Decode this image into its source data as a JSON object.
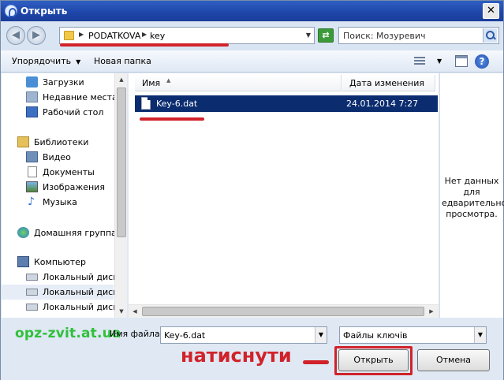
{
  "window": {
    "title": "Открыть",
    "close_glyph": "✕"
  },
  "address": {
    "segments": [
      "PODATKOVA",
      "key"
    ],
    "search_placeholder": "Поиск: Мозуревич"
  },
  "toolbar": {
    "organize_label": "Упорядочить",
    "new_folder_label": "Новая папка",
    "help_label": "?"
  },
  "nav": {
    "items": [
      {
        "label": "Загрузки",
        "icon": "downloads-icon"
      },
      {
        "label": "Недавние места",
        "icon": "recent-places-icon"
      },
      {
        "label": "Рабочий стол",
        "icon": "desktop-icon"
      },
      {
        "label": "Библиотеки",
        "icon": "libraries-icon"
      },
      {
        "label": "Видео",
        "icon": "video-icon"
      },
      {
        "label": "Документы",
        "icon": "documents-icon"
      },
      {
        "label": "Изображения",
        "icon": "pictures-icon"
      },
      {
        "label": "Музыка",
        "icon": "music-icon"
      },
      {
        "label": "Домашняя группа",
        "icon": "homegroup-icon"
      },
      {
        "label": "Компьютер",
        "icon": "computer-icon"
      },
      {
        "label": "Локальный диск (",
        "icon": "disk-icon"
      },
      {
        "label": "Локальный диск (",
        "icon": "disk-icon"
      },
      {
        "label": "Локальный диск (",
        "icon": "disk-icon"
      }
    ]
  },
  "file_list": {
    "columns": [
      "Имя",
      "Дата изменения"
    ],
    "rows": [
      {
        "name": "Key-6.dat",
        "modified": "24.01.2014 7:27",
        "selected": true
      }
    ]
  },
  "preview": {
    "text": "Нет данных для едварительно просмотра."
  },
  "footer": {
    "watermark": "opz-zvit.at.ua",
    "filename_label": "Имя файла:",
    "filename_value": "Key-6.dat",
    "filetype_value": "Файлы ключів",
    "annotation": "натиснути",
    "open_label": "Открыть",
    "cancel_label": "Отмена"
  },
  "colors": {
    "accent_red": "#d1222a",
    "selection": "#0b2c6f",
    "watermark_green": "#2fc03a"
  }
}
